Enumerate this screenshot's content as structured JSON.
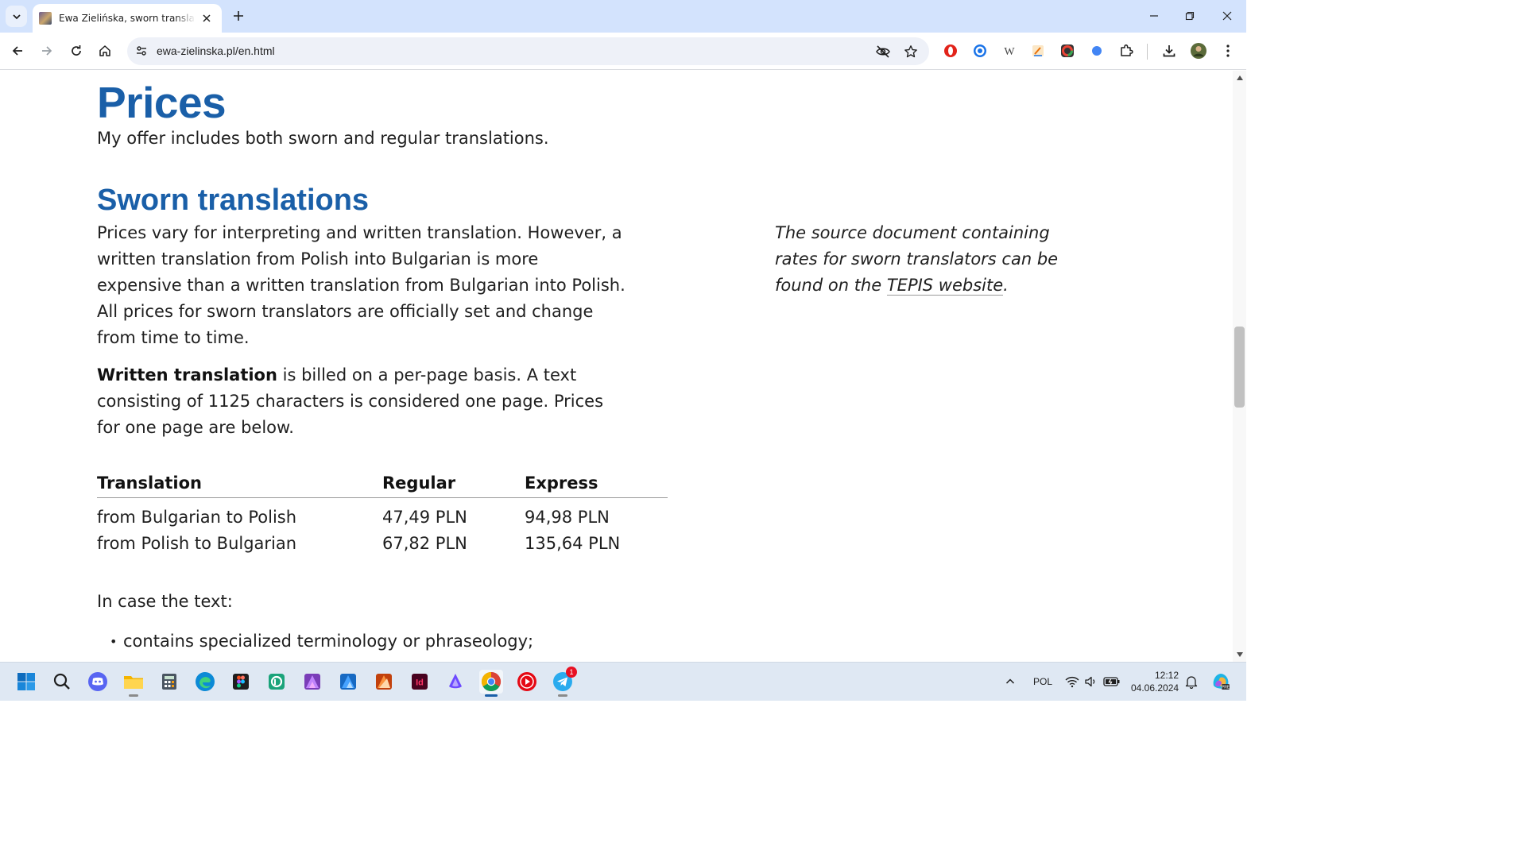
{
  "browser": {
    "tab": {
      "title": "Ewa Zielińska, sworn translator of Bulgarian"
    },
    "url": "ewa-zielinska.pl/en.html"
  },
  "page": {
    "title": "Prices",
    "intro": "My offer includes both sworn and regular translations.",
    "sworn_heading": "Sworn translations",
    "para1": "Prices vary for interpreting and written translation. However, a written translation from Polish into Bulgarian is more expensive than a written translation from Bulgarian into Polish. All prices for sworn translators are officially set and change from time to time.",
    "para2_bold": "Written translation",
    "para2_rest": " is billed on a per-page basis. A text consisting of 1125 characters is considered one page. Prices for one page are below.",
    "aside_text": "The source document containing rates for sworn translators can be found on the ",
    "aside_link": "TEPIS website",
    "aside_end": ".",
    "table": {
      "headers": [
        "Translation",
        "Regular",
        "Express"
      ],
      "rows": [
        [
          "from Bulgarian to Polish",
          "47,49 PLN",
          "94,98 PLN"
        ],
        [
          "from Polish to Bulgarian",
          "67,82 PLN",
          "135,64 PLN"
        ]
      ]
    },
    "case_intro": "In case the text:",
    "bullets": [
      "contains specialized terminology or phraseology;"
    ]
  },
  "taskbar": {
    "language": "POL",
    "time": "12:12",
    "date": "04.06.2024",
    "telegram_badge": "1"
  }
}
